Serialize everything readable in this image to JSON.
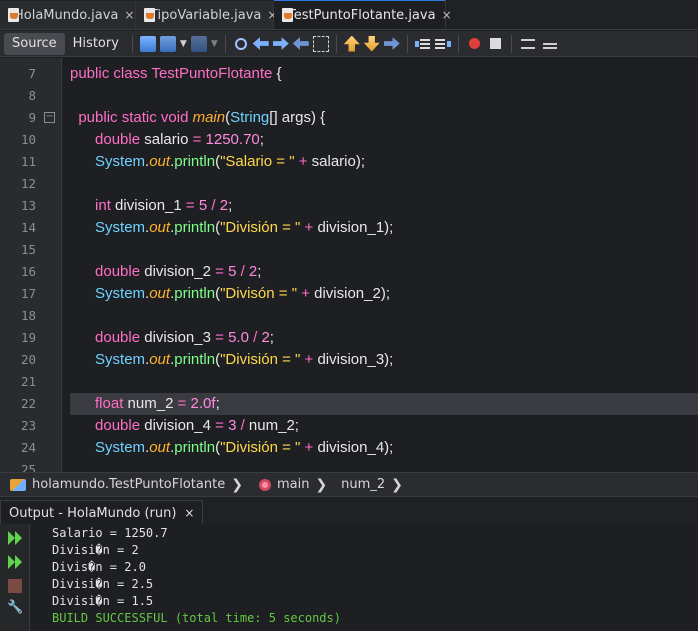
{
  "tabs": [
    {
      "label": "HolaMundo.java",
      "close": "×",
      "active": false
    },
    {
      "label": "TipoVariable.java",
      "close": "×",
      "active": false
    },
    {
      "label": "TestPuntoFlotante.java",
      "close": "×",
      "active": true
    }
  ],
  "toolbar": {
    "source_label": "Source",
    "history_label": "History",
    "icons": [
      "last-edit-icon",
      "back-icon",
      "forward-icon",
      "find-icon",
      "find-previous-icon",
      "find-next-icon",
      "find-selection-icon",
      "toggle-highlight-icon",
      "previous-bookmark-icon",
      "next-bookmark-icon",
      "toggle-bookmark-icon",
      "shift-left-icon",
      "shift-right-icon",
      "start-macro-icon",
      "stop-macro-icon",
      "comment-icon",
      "uncomment-icon"
    ]
  },
  "editor": {
    "lines": [
      {
        "num": "7",
        "tokens": [
          [
            "kw",
            "public "
          ],
          [
            "kw",
            "class "
          ],
          [
            "kw",
            "TestPuntoFlotante"
          ],
          [
            "pl",
            " {"
          ]
        ]
      },
      {
        "num": "8",
        "tokens": []
      },
      {
        "num": "9",
        "tokens": [
          [
            "pl",
            "  "
          ],
          [
            "kw",
            "public "
          ],
          [
            "kw",
            "static "
          ],
          [
            "kw",
            "void "
          ],
          [
            "fn",
            "main"
          ],
          [
            "pl",
            "("
          ],
          [
            "cls",
            "String"
          ],
          [
            "pl",
            "[] args) {"
          ]
        ],
        "fold": "−"
      },
      {
        "num": "10",
        "tokens": [
          [
            "pl",
            "      "
          ],
          [
            "ty",
            "double "
          ],
          [
            "pl",
            "salario "
          ],
          [
            "op",
            "= "
          ],
          [
            "nm",
            "1250.70"
          ],
          [
            "pl",
            ";"
          ]
        ]
      },
      {
        "num": "11",
        "tokens": [
          [
            "pl",
            "      "
          ],
          [
            "cls",
            "System"
          ],
          [
            "pl",
            "."
          ],
          [
            "out",
            "out"
          ],
          [
            "pl",
            "."
          ],
          [
            "mt",
            "println"
          ],
          [
            "pl",
            "("
          ],
          [
            "st",
            "\"Salario = \" "
          ],
          [
            "op",
            "+ "
          ],
          [
            "pl",
            "salario);"
          ]
        ]
      },
      {
        "num": "12",
        "tokens": []
      },
      {
        "num": "13",
        "tokens": [
          [
            "pl",
            "      "
          ],
          [
            "ty",
            "int "
          ],
          [
            "pl",
            "division_1 "
          ],
          [
            "op",
            "= "
          ],
          [
            "nm",
            "5 "
          ],
          [
            "op",
            "/ "
          ],
          [
            "nm",
            "2"
          ],
          [
            "pl",
            ";"
          ]
        ]
      },
      {
        "num": "14",
        "tokens": [
          [
            "pl",
            "      "
          ],
          [
            "cls",
            "System"
          ],
          [
            "pl",
            "."
          ],
          [
            "out",
            "out"
          ],
          [
            "pl",
            "."
          ],
          [
            "mt",
            "println"
          ],
          [
            "pl",
            "("
          ],
          [
            "st",
            "\"División = \" "
          ],
          [
            "op",
            "+ "
          ],
          [
            "pl",
            "division_1);"
          ]
        ]
      },
      {
        "num": "15",
        "tokens": []
      },
      {
        "num": "16",
        "tokens": [
          [
            "pl",
            "      "
          ],
          [
            "ty",
            "double "
          ],
          [
            "pl",
            "division_2 "
          ],
          [
            "op",
            "= "
          ],
          [
            "nm",
            "5 "
          ],
          [
            "op",
            "/ "
          ],
          [
            "nm",
            "2"
          ],
          [
            "pl",
            ";"
          ]
        ]
      },
      {
        "num": "17",
        "tokens": [
          [
            "pl",
            "      "
          ],
          [
            "cls",
            "System"
          ],
          [
            "pl",
            "."
          ],
          [
            "out",
            "out"
          ],
          [
            "pl",
            "."
          ],
          [
            "mt",
            "println"
          ],
          [
            "pl",
            "("
          ],
          [
            "st",
            "\"Divisón = \" "
          ],
          [
            "op",
            "+ "
          ],
          [
            "pl",
            "division_2);"
          ]
        ]
      },
      {
        "num": "18",
        "tokens": []
      },
      {
        "num": "19",
        "tokens": [
          [
            "pl",
            "      "
          ],
          [
            "ty",
            "double "
          ],
          [
            "pl",
            "division_3 "
          ],
          [
            "op",
            "= "
          ],
          [
            "nm",
            "5.0 "
          ],
          [
            "op",
            "/ "
          ],
          [
            "nm",
            "2"
          ],
          [
            "pl",
            ";"
          ]
        ]
      },
      {
        "num": "20",
        "tokens": [
          [
            "pl",
            "      "
          ],
          [
            "cls",
            "System"
          ],
          [
            "pl",
            "."
          ],
          [
            "out",
            "out"
          ],
          [
            "pl",
            "."
          ],
          [
            "mt",
            "println"
          ],
          [
            "pl",
            "("
          ],
          [
            "st",
            "\"División = \" "
          ],
          [
            "op",
            "+ "
          ],
          [
            "pl",
            "division_3);"
          ]
        ]
      },
      {
        "num": "21",
        "tokens": []
      },
      {
        "num": "22",
        "tokens": [
          [
            "pl",
            "      "
          ],
          [
            "ty",
            "float "
          ],
          [
            "pl",
            "num_2 "
          ],
          [
            "op",
            "= "
          ],
          [
            "nm",
            "2.0f"
          ],
          [
            "pl",
            ";"
          ]
        ],
        "highlight": true
      },
      {
        "num": "23",
        "tokens": [
          [
            "pl",
            "      "
          ],
          [
            "ty",
            "double "
          ],
          [
            "pl",
            "division_4 "
          ],
          [
            "op",
            "= "
          ],
          [
            "nm",
            "3 "
          ],
          [
            "op",
            "/ "
          ],
          [
            "pl",
            "num_2;"
          ]
        ]
      },
      {
        "num": "24",
        "tokens": [
          [
            "pl",
            "      "
          ],
          [
            "cls",
            "System"
          ],
          [
            "pl",
            "."
          ],
          [
            "out",
            "out"
          ],
          [
            "pl",
            "."
          ],
          [
            "mt",
            "println"
          ],
          [
            "pl",
            "("
          ],
          [
            "st",
            "\"División = \" "
          ],
          [
            "op",
            "+ "
          ],
          [
            "pl",
            "division_4);"
          ]
        ]
      },
      {
        "num": "25",
        "tokens": []
      }
    ]
  },
  "breadcrumb": {
    "items": [
      {
        "label": "holamundo.TestPuntoFlotante",
        "icon": "package-class-icon"
      },
      {
        "label": "main",
        "icon": "method-icon"
      },
      {
        "label": "num_2",
        "icon": ""
      }
    ],
    "separator": "❯"
  },
  "output": {
    "tab_label": "Output - HolaMundo (run)",
    "close": "×",
    "lines": [
      "Salario = 1250.7",
      "Divisi�n = 2",
      "Divis�n = 2.0",
      "Divisi�n = 2.5",
      "Divisi�n = 1.5",
      "BUILD SUCCESSFUL (total time: 5 seconds)"
    ],
    "side_icons": [
      "rerun-icon",
      "rerun-with-params-icon",
      "stop-icon",
      "settings-wrench-icon"
    ]
  },
  "colors": {
    "keyword": "#ff6ec7",
    "string": "#ffd84a",
    "method": "#7dff8a",
    "class": "#6ed3ff",
    "success": "#63c943",
    "tab_accent": "#2f7de1"
  }
}
